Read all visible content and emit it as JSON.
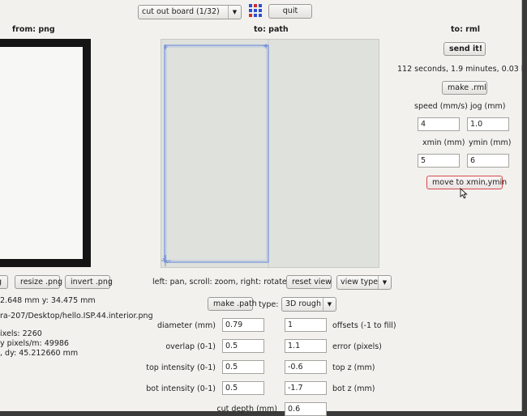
{
  "toolbar": {
    "process_select": "cut out board (1/32)",
    "quit_label": "quit"
  },
  "columns": {
    "png_header": "from: png",
    "path_header": "to: path",
    "rml_header": "to: rml"
  },
  "rml": {
    "send_label": "send it!",
    "time_estimate": "112 seconds, 1.9 minutes, 0.03 hours",
    "make_rml_label": "make .rml",
    "speed_label": "speed (mm/s)",
    "jog_label": "jog (mm)",
    "speed_value": "4",
    "jog_value": "1.0",
    "xmin_label": "xmin (mm)",
    "ymin_label": "ymin (mm)",
    "xmin_value": "5",
    "ymin_value": "6",
    "move_label": "move to xmin,ymin"
  },
  "png": {
    "partial_button_label": "g",
    "resize_label": "resize .png",
    "invert_label": "invert .png",
    "size_info": "2.648 mm  y: 34.475 mm",
    "file_path": "ra-207/Desktop/hello.ISP.44.interior.png",
    "pixels_info": "ixels: 2260",
    "ppm_info": "y pixels/m: 49986",
    "dy_info": ", dy: 45.212660 mm"
  },
  "path": {
    "view_hint": "left: pan, scroll: zoom, right: rotate",
    "reset_view_label": "reset view",
    "view_type_label": "view type",
    "make_path_label": "make .path",
    "type_label": "type:",
    "type_value": "3D rough"
  },
  "params": [
    {
      "left_label": "diameter (mm)",
      "left_value": "0.79",
      "right_value": "1",
      "right_label": "offsets (-1 to fill)"
    },
    {
      "left_label": "overlap (0-1)",
      "left_value": "0.5",
      "right_value": "1.1",
      "right_label": "error (pixels)"
    },
    {
      "left_label": "top intensity (0-1)",
      "left_value": "0.5",
      "right_value": "-0.6",
      "right_label": "top z (mm)"
    },
    {
      "left_label": "bot intensity (0-1)",
      "left_value": "0.5",
      "right_value": "-1.7",
      "right_label": "bot z (mm)"
    }
  ],
  "cut_depth": {
    "label": "cut depth (mm)",
    "value": "0.6"
  },
  "colors": {
    "accent_red": "#d54a4a",
    "path_blue": "#6f8fd8",
    "canvas_bg": "#dfe1dc"
  },
  "icons": {
    "app_grid": "grid-icon",
    "dropdown": "chevron-down-icon",
    "cursor": "mouse-cursor-icon"
  }
}
